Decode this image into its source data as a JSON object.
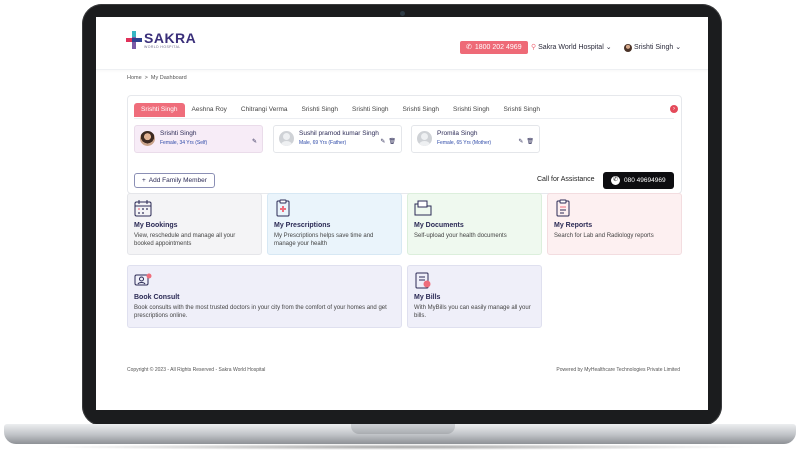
{
  "header": {
    "logo_name": "SAKRA",
    "logo_sub": "WORLD HOSPITAL",
    "phone": "1800 202 4969",
    "hospital": "Sakra World Hospital",
    "user": "Srishti Singh"
  },
  "breadcrumb": [
    "Home",
    ">",
    "My Dashboard"
  ],
  "family": {
    "tabs": [
      "Srishti Singh",
      "Aeshna Roy",
      "Chitrangi Verma",
      "Srishti Singh",
      "Srishti Singh",
      "Srishti Singh",
      "Srishti Singh",
      "Srishti Singh"
    ],
    "members": [
      {
        "name": "Srishti Singh",
        "info": "Female, 34 Yrs (Self)"
      },
      {
        "name": "Sushil pramod kumar Singh",
        "info": "Male, 69 Yrs (Father)"
      },
      {
        "name": "Promila Singh",
        "info": "Female, 65 Yrs (Mother)"
      }
    ],
    "add_label": "Add Family Member",
    "assist_label": "Call for Assistance",
    "assist_phone": "080 49694969"
  },
  "cards": {
    "bookings": {
      "title": "My Bookings",
      "desc": "View, reschedule and manage all your booked appointments"
    },
    "prescriptions": {
      "title": "My Prescriptions",
      "desc": "My Prescriptions helps save time and manage your health"
    },
    "documents": {
      "title": "My Documents",
      "desc": "Self-upload your health documents"
    },
    "reports": {
      "title": "My Reports",
      "desc": "Search for Lab and Radiology reports"
    },
    "consult": {
      "title": "Book Consult",
      "desc": "Book consults with the most trusted doctors in your city from the comfort of your homes and get prescriptions online."
    },
    "bills": {
      "title": "My Bills",
      "desc": "With MyBills you can easily manage all your bills."
    }
  },
  "footer": {
    "left": "Copyright © 2023 - All Rights Reserved - Sakra World Hospital",
    "right": "Powered by MyHealthcare Technologies Private Limited"
  },
  "colors": {
    "accent": "#ef6d7b",
    "navy": "#2b2a55",
    "dark_button": "#0d0d10"
  }
}
